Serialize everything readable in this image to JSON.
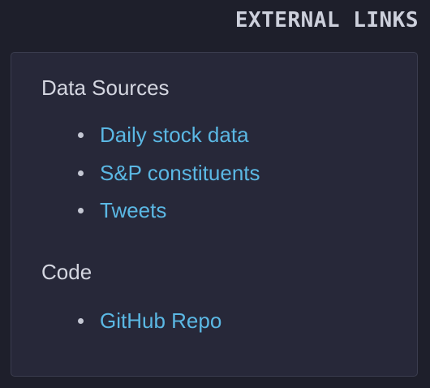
{
  "header": {
    "title": "EXTERNAL LINKS"
  },
  "sections": [
    {
      "title": "Data Sources",
      "links": [
        {
          "label": "Daily stock data"
        },
        {
          "label": "S&P constituents"
        },
        {
          "label": "Tweets"
        }
      ]
    },
    {
      "title": "Code",
      "links": [
        {
          "label": "GitHub Repo"
        }
      ]
    }
  ],
  "colors": {
    "page_background": "#1e1f2b",
    "card_background": "#272839",
    "link": "#5bb8e4",
    "text": "#d4d6e0"
  }
}
